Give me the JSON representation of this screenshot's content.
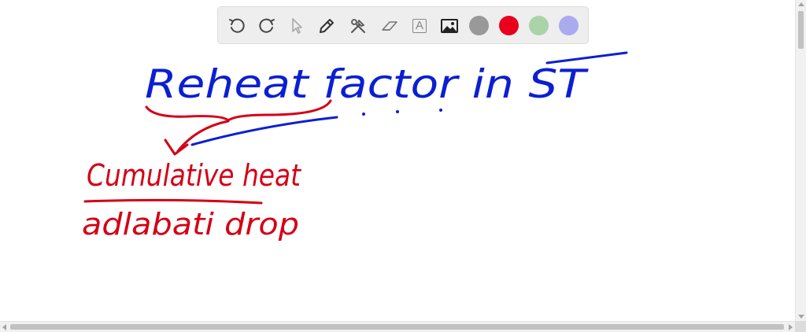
{
  "toolbar": {
    "tools": [
      {
        "name": "undo-icon"
      },
      {
        "name": "redo-icon"
      },
      {
        "name": "pointer-icon"
      },
      {
        "name": "pen-icon"
      },
      {
        "name": "tools-icon"
      },
      {
        "name": "eraser-icon"
      },
      {
        "name": "text-icon",
        "glyph": "A"
      },
      {
        "name": "image-icon"
      }
    ],
    "colors": [
      "#999999",
      "#e8001c",
      "#aad3a8",
      "#aaaaee"
    ]
  },
  "ink": {
    "blue": "#0b1fd1",
    "red": "#d40017"
  },
  "canvas_text": {
    "title": "Reheat factor in ST",
    "numerator": "Cumulative heat",
    "denominator": "adlabati drop"
  }
}
